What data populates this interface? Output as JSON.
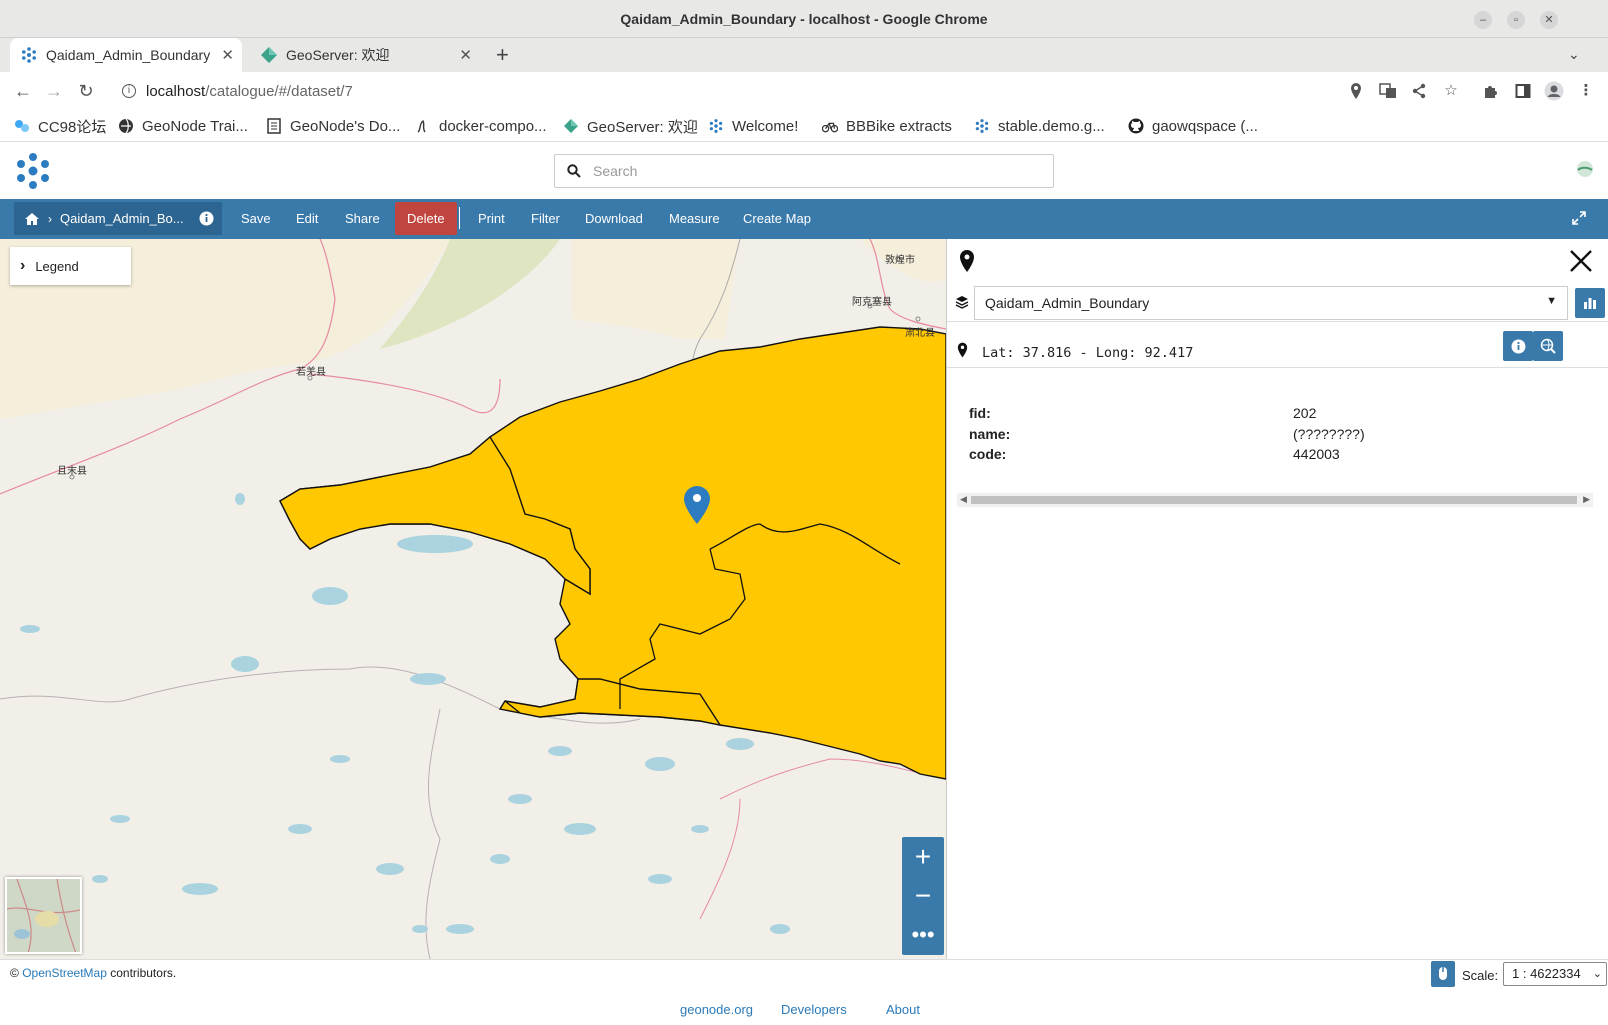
{
  "window": {
    "title": "Qaidam_Admin_Boundary - localhost - Google Chrome"
  },
  "tabs": [
    {
      "label": "Qaidam_Admin_Boundary"
    },
    {
      "label": "GeoServer: 欢迎"
    }
  ],
  "address": {
    "host": "localhost",
    "path": "/catalogue/#/dataset/7"
  },
  "bookmarks": [
    {
      "label": "CC98论坛",
      "icon": "cc98-icon"
    },
    {
      "label": "GeoNode Trai...",
      "icon": "globe-icon"
    },
    {
      "label": "GeoNode's Do...",
      "icon": "docs-icon"
    },
    {
      "label": "docker-compo...",
      "icon": "docker-icon"
    },
    {
      "label": "GeoServer: 欢迎",
      "icon": "geoserver-icon"
    },
    {
      "label": "Welcome!",
      "icon": "geonode-icon"
    },
    {
      "label": "BBBike extracts",
      "icon": "bike-icon"
    },
    {
      "label": "stable.demo.g...",
      "icon": "geonode-icon"
    },
    {
      "label": "gaowqspace (...",
      "icon": "github-icon"
    }
  ],
  "search": {
    "placeholder": "Search"
  },
  "toolbar": {
    "breadcrumb": "Qaidam_Admin_Bo...",
    "buttons": [
      "Save",
      "Edit",
      "Share",
      "Delete",
      "Print",
      "Filter",
      "Download",
      "Measure",
      "Create Map"
    ]
  },
  "map": {
    "legend_label": "Legend",
    "place_labels": [
      "敦煌市",
      "阿克塞县",
      "肃北县",
      "若羌县",
      "且末县"
    ],
    "colors": {
      "land": "#f2efe9",
      "boundary_fill": "#ffc800",
      "water": "#aad3df",
      "road": "#e68aa0"
    }
  },
  "identify": {
    "layer": "Qaidam_Admin_Boundary",
    "coords": "Lat: 37.816 - Long: 92.417",
    "attributes": [
      {
        "key": "fid:",
        "value": "202"
      },
      {
        "key": "name:",
        "value": "(????????)"
      },
      {
        "key": "code:",
        "value": "442003"
      }
    ]
  },
  "footer": {
    "attribution_prefix": "©",
    "attribution_link": "OpenStreetMap",
    "attribution_suffix": " contributors.",
    "scale_label": "Scale:",
    "scale_value": "1 : 4622334",
    "links": [
      "geonode.org",
      "Developers",
      "About"
    ]
  }
}
